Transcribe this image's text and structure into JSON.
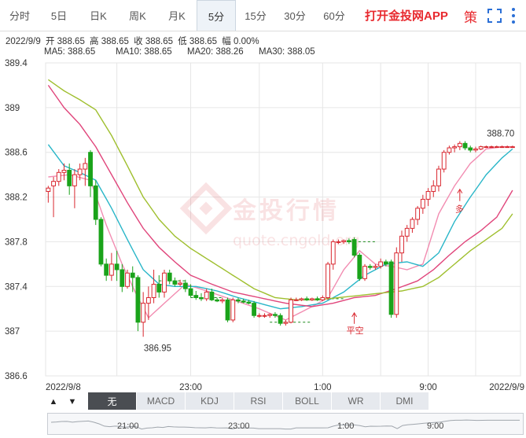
{
  "tabs": [
    {
      "label": "分时",
      "active": false
    },
    {
      "label": "5日",
      "active": false
    },
    {
      "label": "日K",
      "active": false
    },
    {
      "label": "周K",
      "active": false
    },
    {
      "label": "月K",
      "active": false
    },
    {
      "label": "5分",
      "active": true
    },
    {
      "label": "15分",
      "active": false
    },
    {
      "label": "30分",
      "active": false
    },
    {
      "label": "60分",
      "active": false
    }
  ],
  "promo": "打开金投网APP",
  "policy_icon": "策",
  "info": {
    "date": "2022/9/9",
    "open": "开 388.65",
    "high": "高 388.65",
    "close": "收 388.65",
    "low": "低 388.65",
    "change": "幅 0.00%"
  },
  "ma_legend": [
    {
      "label": "MA5: 388.65",
      "color": "#f28cb1"
    },
    {
      "label": "MA10: 388.65",
      "color": "#29b6c8"
    },
    {
      "label": "MA20: 388.26",
      "color": "#e0457b"
    },
    {
      "label": "MA30: 388.05",
      "color": "#9fbf2e"
    }
  ],
  "watermark": {
    "brand": "金投行情",
    "url": "quote.cngold.org"
  },
  "indicators": [
    {
      "label": "无",
      "active": true
    },
    {
      "label": "MACD",
      "active": false
    },
    {
      "label": "KDJ",
      "active": false
    },
    {
      "label": "RSI",
      "active": false
    },
    {
      "label": "BOLL",
      "active": false
    },
    {
      "label": "WR",
      "active": false
    },
    {
      "label": "DMI",
      "active": false
    }
  ],
  "nav_arrows": {
    "up": "▲",
    "down": "▼"
  },
  "overview_labels": [
    "21:00",
    "23:00",
    "1:00",
    "9:00"
  ],
  "colors": {
    "up": "#d9272f",
    "down": "#1aa31a",
    "grid": "#e6e6e6",
    "axis": "#333333"
  },
  "chart_data": {
    "type": "candlestick",
    "y_ticks": [
      "389.4",
      "389",
      "388.6",
      "388.2",
      "387.8",
      "387.4",
      "387",
      "386.6"
    ],
    "ylim": [
      386.6,
      389.4
    ],
    "x_ticks": [
      {
        "label": "2022/9/8",
        "index": 0
      },
      {
        "label": "23:00",
        "index": 27
      },
      {
        "label": "1:00",
        "index": 52
      },
      {
        "label": "9:00",
        "index": 72
      },
      {
        "label": "2022/9/9",
        "index": 89
      }
    ],
    "n_slots": 89,
    "annotations": [
      {
        "text": "386.95",
        "index": 19,
        "value": 386.95
      },
      {
        "text": "388.70",
        "index": 84,
        "value": 388.7
      },
      {
        "text": "多",
        "index": 78,
        "value": 388.15
      },
      {
        "text": "平空",
        "index": 58,
        "value": 387.15
      }
    ],
    "candles": [
      [
        388.25,
        388.3,
        388.15,
        388.28
      ],
      [
        388.3,
        388.38,
        388.02,
        388.34
      ],
      [
        388.34,
        388.45,
        388.3,
        388.42
      ],
      [
        388.42,
        388.5,
        388.35,
        388.44
      ],
      [
        388.44,
        388.5,
        388.22,
        388.3
      ],
      [
        388.3,
        388.45,
        388.1,
        388.4
      ],
      [
        388.4,
        388.5,
        388.35,
        388.45
      ],
      [
        388.45,
        388.55,
        388.3,
        388.5
      ],
      [
        388.6,
        388.62,
        388.2,
        388.3
      ],
      [
        388.3,
        388.35,
        387.95,
        388.0
      ],
      [
        388.0,
        388.02,
        387.58,
        387.6
      ],
      [
        387.6,
        387.65,
        387.45,
        387.5
      ],
      [
        387.5,
        387.7,
        387.45,
        387.6
      ],
      [
        387.6,
        387.72,
        387.45,
        387.55
      ],
      [
        387.55,
        387.6,
        387.35,
        387.4
      ],
      [
        387.4,
        387.55,
        387.38,
        387.52
      ],
      [
        387.52,
        387.58,
        387.35,
        387.48
      ],
      [
        387.48,
        387.5,
        387.0,
        387.08
      ],
      [
        387.08,
        387.35,
        386.95,
        387.25
      ],
      [
        387.25,
        387.4,
        387.1,
        387.3
      ],
      [
        387.3,
        387.55,
        387.25,
        387.42
      ],
      [
        387.42,
        387.5,
        387.3,
        387.35
      ],
      [
        387.35,
        387.55,
        387.3,
        387.52
      ],
      [
        387.52,
        387.55,
        387.42,
        387.45
      ],
      [
        387.45,
        387.48,
        387.4,
        387.42
      ],
      [
        387.42,
        387.46,
        387.4,
        387.43
      ],
      [
        387.43,
        387.46,
        387.35,
        387.38
      ],
      [
        387.38,
        387.42,
        387.3,
        387.32
      ],
      [
        387.32,
        387.36,
        387.28,
        387.3
      ],
      [
        387.3,
        387.34,
        387.27,
        387.29
      ],
      [
        387.29,
        387.38,
        387.27,
        387.35
      ],
      [
        387.35,
        387.38,
        387.27,
        387.28
      ],
      [
        387.28,
        387.3,
        387.26,
        387.27
      ],
      [
        387.27,
        387.3,
        387.25,
        387.28
      ],
      [
        387.28,
        387.3,
        387.08,
        387.1
      ],
      [
        387.1,
        387.3,
        387.08,
        387.28
      ],
      [
        387.28,
        387.3,
        387.25,
        387.27
      ],
      [
        387.27,
        387.29,
        387.25,
        387.26
      ],
      [
        387.26,
        387.28,
        387.24,
        387.25
      ],
      [
        387.25,
        387.27,
        387.12,
        387.14
      ],
      [
        387.14,
        387.16,
        387.12,
        387.14
      ],
      [
        387.14,
        387.16,
        387.12,
        387.14
      ],
      [
        387.14,
        387.16,
        387.12,
        387.15
      ],
      [
        387.15,
        387.17,
        387.12,
        387.14
      ],
      [
        387.14,
        387.16,
        387.05,
        387.07
      ],
      [
        387.07,
        387.1,
        387.05,
        387.08
      ],
      [
        387.08,
        387.3,
        387.07,
        387.28
      ],
      [
        387.28,
        387.3,
        387.27,
        387.28
      ],
      [
        387.28,
        387.3,
        387.27,
        387.29
      ],
      [
        387.29,
        387.31,
        387.27,
        387.28
      ],
      [
        387.28,
        387.3,
        387.27,
        387.29
      ],
      [
        387.29,
        387.31,
        387.27,
        387.28
      ],
      [
        387.28,
        387.32,
        387.27,
        387.3
      ],
      [
        387.3,
        387.62,
        387.28,
        387.6
      ],
      [
        387.6,
        387.82,
        387.55,
        387.8
      ],
      [
        387.8,
        387.82,
        387.78,
        387.8
      ],
      [
        387.8,
        387.82,
        387.78,
        387.81
      ],
      [
        387.81,
        387.83,
        387.78,
        387.8
      ],
      [
        387.82,
        387.84,
        387.66,
        387.68
      ],
      [
        387.68,
        387.7,
        387.45,
        387.47
      ],
      [
        387.47,
        387.6,
        387.45,
        387.58
      ],
      [
        387.58,
        387.6,
        387.55,
        387.57
      ],
      [
        387.57,
        387.6,
        387.55,
        387.58
      ],
      [
        387.58,
        387.65,
        387.56,
        387.62
      ],
      [
        387.62,
        387.64,
        387.58,
        387.6
      ],
      [
        387.62,
        387.64,
        387.12,
        387.15
      ],
      [
        387.15,
        387.75,
        387.12,
        387.7
      ],
      [
        387.7,
        387.9,
        387.62,
        387.85
      ],
      [
        387.85,
        387.95,
        387.8,
        387.92
      ],
      [
        387.92,
        388.02,
        387.88,
        388.0
      ],
      [
        388.0,
        388.12,
        387.95,
        388.1
      ],
      [
        388.1,
        388.22,
        388.05,
        388.18
      ],
      [
        388.18,
        388.28,
        388.12,
        388.25
      ],
      [
        388.25,
        388.35,
        388.2,
        388.3
      ],
      [
        388.3,
        388.48,
        388.25,
        388.45
      ],
      [
        388.45,
        388.62,
        388.42,
        388.6
      ],
      [
        388.6,
        388.66,
        388.58,
        388.64
      ],
      [
        388.64,
        388.67,
        388.6,
        388.65
      ],
      [
        388.65,
        388.7,
        388.62,
        388.68
      ],
      [
        388.68,
        388.7,
        388.62,
        388.64
      ],
      [
        388.64,
        388.66,
        388.6,
        388.62
      ],
      [
        388.62,
        388.65,
        388.6,
        388.63
      ],
      [
        388.63,
        388.66,
        388.62,
        388.65
      ],
      [
        388.65,
        388.66,
        388.64,
        388.65
      ],
      [
        388.65,
        388.66,
        388.64,
        388.65
      ],
      [
        388.65,
        388.66,
        388.64,
        388.65
      ],
      [
        388.65,
        388.66,
        388.64,
        388.65
      ],
      [
        388.65,
        388.66,
        388.64,
        388.65
      ],
      [
        388.65,
        388.66,
        388.64,
        388.65
      ]
    ],
    "ma_lines": [
      {
        "name": "MA5",
        "color": "#f28cb1",
        "keys": [
          [
            0,
            388.38
          ],
          [
            4,
            388.4
          ],
          [
            8,
            388.35
          ],
          [
            11,
            387.95
          ],
          [
            14,
            387.6
          ],
          [
            17,
            387.3
          ],
          [
            19,
            387.12
          ],
          [
            22,
            387.25
          ],
          [
            26,
            387.42
          ],
          [
            30,
            387.36
          ],
          [
            35,
            387.28
          ],
          [
            40,
            387.2
          ],
          [
            45,
            387.1
          ],
          [
            50,
            387.22
          ],
          [
            53,
            387.3
          ],
          [
            56,
            387.55
          ],
          [
            59,
            387.72
          ],
          [
            62,
            387.6
          ],
          [
            65,
            387.58
          ],
          [
            68,
            387.55
          ],
          [
            71,
            387.6
          ],
          [
            74,
            388.05
          ],
          [
            77,
            388.3
          ],
          [
            80,
            388.5
          ],
          [
            83,
            388.63
          ],
          [
            86,
            388.65
          ],
          [
            88,
            388.65
          ]
        ]
      },
      {
        "name": "MA10",
        "color": "#29b6c8",
        "keys": [
          [
            0,
            388.67
          ],
          [
            3,
            388.48
          ],
          [
            6,
            388.42
          ],
          [
            9,
            388.35
          ],
          [
            12,
            388.1
          ],
          [
            15,
            387.82
          ],
          [
            18,
            387.55
          ],
          [
            21,
            387.42
          ],
          [
            24,
            387.4
          ],
          [
            28,
            387.4
          ],
          [
            32,
            387.36
          ],
          [
            36,
            387.3
          ],
          [
            40,
            387.25
          ],
          [
            44,
            387.2
          ],
          [
            48,
            387.22
          ],
          [
            52,
            387.25
          ],
          [
            56,
            387.35
          ],
          [
            60,
            387.5
          ],
          [
            64,
            387.6
          ],
          [
            68,
            387.62
          ],
          [
            71,
            387.58
          ],
          [
            74,
            387.7
          ],
          [
            77,
            387.98
          ],
          [
            80,
            388.2
          ],
          [
            83,
            388.4
          ],
          [
            86,
            388.55
          ],
          [
            88,
            388.63
          ]
        ]
      },
      {
        "name": "MA20",
        "color": "#e0457b",
        "keys": [
          [
            0,
            389.2
          ],
          [
            3,
            389.0
          ],
          [
            6,
            388.85
          ],
          [
            9,
            388.65
          ],
          [
            12,
            388.4
          ],
          [
            15,
            388.15
          ],
          [
            18,
            387.92
          ],
          [
            21,
            387.75
          ],
          [
            24,
            387.62
          ],
          [
            27,
            387.5
          ],
          [
            31,
            387.42
          ],
          [
            35,
            387.35
          ],
          [
            40,
            387.3
          ],
          [
            45,
            387.25
          ],
          [
            50,
            387.22
          ],
          [
            54,
            387.25
          ],
          [
            58,
            387.3
          ],
          [
            62,
            387.32
          ],
          [
            66,
            387.38
          ],
          [
            70,
            387.45
          ],
          [
            73,
            387.55
          ],
          [
            76,
            387.68
          ],
          [
            79,
            387.8
          ],
          [
            82,
            387.9
          ],
          [
            85,
            388.02
          ],
          [
            88,
            388.26
          ]
        ]
      },
      {
        "name": "MA30",
        "color": "#9fbf2e",
        "keys": [
          [
            0,
            389.25
          ],
          [
            3,
            389.15
          ],
          [
            6,
            389.07
          ],
          [
            9,
            388.98
          ],
          [
            12,
            388.75
          ],
          [
            15,
            388.48
          ],
          [
            18,
            388.2
          ],
          [
            21,
            388.0
          ],
          [
            24,
            387.85
          ],
          [
            27,
            387.74
          ],
          [
            31,
            387.62
          ],
          [
            35,
            387.5
          ],
          [
            39,
            387.38
          ],
          [
            43,
            387.3
          ],
          [
            47,
            387.28
          ],
          [
            51,
            387.28
          ],
          [
            55,
            387.3
          ],
          [
            59,
            387.32
          ],
          [
            63,
            387.34
          ],
          [
            67,
            387.36
          ],
          [
            71,
            387.4
          ],
          [
            74,
            387.48
          ],
          [
            77,
            387.6
          ],
          [
            80,
            387.72
          ],
          [
            83,
            387.82
          ],
          [
            86,
            387.92
          ],
          [
            88,
            388.05
          ]
        ]
      }
    ],
    "dashed_segments": [
      {
        "from": 21,
        "to": 26,
        "value": 387.45
      },
      {
        "from": 27,
        "to": 33,
        "value": 387.3
      },
      {
        "from": 42,
        "to": 50,
        "value": 387.08
      },
      {
        "from": 51,
        "to": 56,
        "value": 387.29
      },
      {
        "from": 57,
        "to": 62,
        "value": 387.8
      },
      {
        "from": 82,
        "to": 88,
        "value": 388.65
      }
    ]
  }
}
